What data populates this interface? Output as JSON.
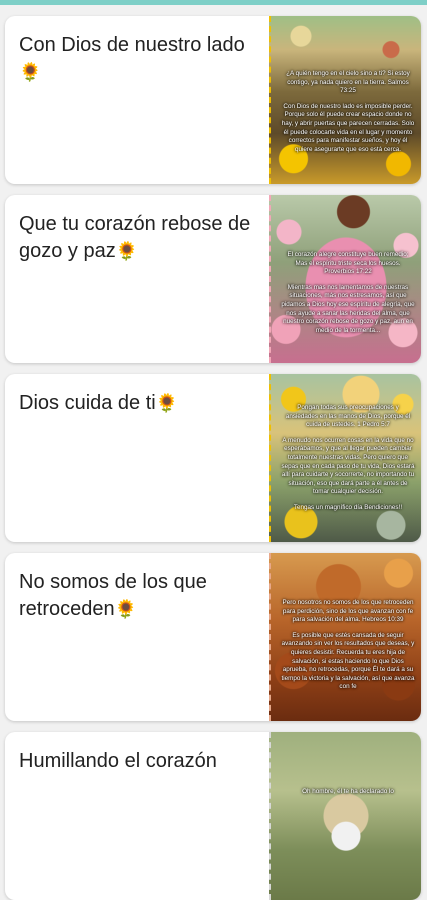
{
  "colors": {
    "accent_bar": "#7ecfc7",
    "card_bg": "#ffffff",
    "page_bg": "#f1f1f1"
  },
  "sunflower_icon": "🌻",
  "posts": [
    {
      "title": "Con Dios de nuestro lado",
      "emoji": "🌻",
      "image_text": [
        "¿A quién tengo en el cielo sino a ti? Si estoy contigo, ya nada quiero en la tierra. Salmos 73:25",
        "Con Dios de nuestro lado es imposible perder. Porque solo él puede crear espacio donde no hay, y abrir puertas que parecen cerradas. Solo él puede colocarte vida en el lugar y momento correctos para manifestar sueños, y hoy él quiere asegurarte que eso está cerca."
      ]
    },
    {
      "title": "Que tu corazón rebose de gozo y paz",
      "emoji": "🌻",
      "image_text": [
        "El corazón alegre constituye buen remedio; Mas el espíritu triste seca los huesos. Proverbios 17:22",
        "Mientras mas nos lamentamos de nuestras situaciones, más nos estresamos, así que pidamos a Dios hoy ese espíritu de alegría, que nos ayude a sanar las heridas del alma, que nuestro corazón rebose de gozo y paz, aun en medio de la tormenta..."
      ]
    },
    {
      "title": "Dios cuida de ti",
      "emoji": "🌻",
      "image_text": [
        "Pongan todas sus preocupaciones y ansiedades en las manos de Dios, porque él cuida de ustedes. 1 Pedro 5:7",
        "A menudo nos ocurren cosas en la vida que no esperábamos, y que al llegar pueden cambiar totalmente nuestras vidas. Pero quiero que sepas que en cada paso de tu vida, Dios estará allí para cuidarte y socorrerte, no importando tu situación, eso que dará parte a él antes de tomar cualquier decisión.",
        "Tengas un magnífico día Bendiciones!!"
      ]
    },
    {
      "title": "No somos de los que retroceden",
      "emoji": "🌻",
      "image_text": [
        "Pero nosotros no somos de los que retroceden para perdición, sino de los que avanzan con fe para salvación del alma. Hebreos 10:39",
        "Es posible que estés cansada de seguir avanzando sin ver los resultados que deseas, y quieres desistir. Recuerda tu eres hija de salvación, si estas haciendo lo que Dios aprueba, no retrocedas, porque Él te dará a su tiempo la victoria y la salvación, así que avanza con fe"
      ]
    },
    {
      "title": "Humillando el corazón",
      "emoji": "",
      "image_text": [
        "Oh hombre, él te ha declarado lo"
      ]
    }
  ]
}
